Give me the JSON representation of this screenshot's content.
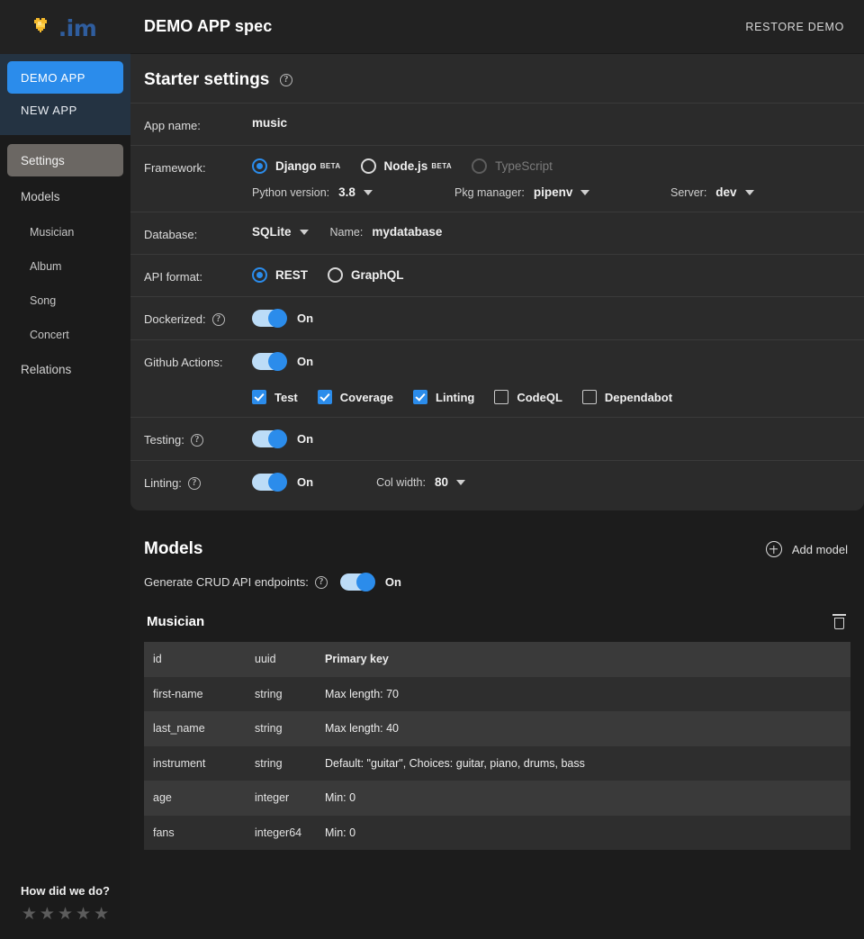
{
  "topbar": {
    "logo_icon": "heart-pixel-icon",
    "logo_text": ".im",
    "title": "DEMO APP spec",
    "restore_label": "RESTORE DEMO"
  },
  "sidebar": {
    "apps": [
      {
        "label": "DEMO APP",
        "active": true
      },
      {
        "label": "NEW APP",
        "active": false
      }
    ],
    "nav": [
      {
        "label": "Settings",
        "selected": true
      },
      {
        "label": "Models",
        "selected": false
      },
      {
        "label": "Musician",
        "sub": true
      },
      {
        "label": "Album",
        "sub": true
      },
      {
        "label": "Song",
        "sub": true
      },
      {
        "label": "Concert",
        "sub": true
      },
      {
        "label": "Relations",
        "selected": false
      }
    ],
    "rating": {
      "label": "How did we do?",
      "stars": 5,
      "filled": 0,
      "star_glyph": "★"
    }
  },
  "settings": {
    "title": "Starter settings",
    "app_name": {
      "label": "App name:",
      "value": "music"
    },
    "framework": {
      "label": "Framework:",
      "options": [
        {
          "label": "Django",
          "badge": "BETA",
          "selected": true,
          "disabled": false
        },
        {
          "label": "Node.js",
          "badge": "BETA",
          "selected": false,
          "disabled": false
        },
        {
          "label": "TypeScript",
          "badge": "",
          "selected": false,
          "disabled": true
        }
      ],
      "python_version": {
        "label": "Python version:",
        "value": "3.8"
      },
      "pkg_manager": {
        "label": "Pkg manager:",
        "value": "pipenv"
      },
      "server": {
        "label": "Server:",
        "value": "dev"
      }
    },
    "database": {
      "label": "Database:",
      "engine": "SQLite",
      "name_label": "Name:",
      "name_value": "mydatabase"
    },
    "api_format": {
      "label": "API format:",
      "options": [
        {
          "label": "REST",
          "selected": true
        },
        {
          "label": "GraphQL",
          "selected": false
        }
      ]
    },
    "dockerized": {
      "label": "Dockerized:",
      "state": "On"
    },
    "github_actions": {
      "label": "Github Actions:",
      "state": "On",
      "checks": [
        {
          "label": "Test",
          "checked": true
        },
        {
          "label": "Coverage",
          "checked": true
        },
        {
          "label": "Linting",
          "checked": true
        },
        {
          "label": "CodeQL",
          "checked": false
        },
        {
          "label": "Dependabot",
          "checked": false
        }
      ]
    },
    "testing": {
      "label": "Testing:",
      "state": "On"
    },
    "linting": {
      "label": "Linting:",
      "state": "On",
      "col_width_label": "Col width:",
      "col_width_value": "80"
    }
  },
  "models": {
    "title": "Models",
    "add_model_label": "Add model",
    "crud": {
      "label": "Generate CRUD API endpoints:",
      "state": "On"
    },
    "card": {
      "name": "Musician",
      "rows": [
        {
          "name": "id",
          "type": "uuid",
          "options": "Primary key"
        },
        {
          "name": "first-name",
          "type": "string",
          "options": "Max length: 70"
        },
        {
          "name": "last_name",
          "type": "string",
          "options": "Max length: 40"
        },
        {
          "name": "instrument",
          "type": "string",
          "options": "Default: \"guitar\", Choices: guitar, piano, drums, bass"
        },
        {
          "name": "age",
          "type": "integer",
          "options": "Min: 0"
        },
        {
          "name": "fans",
          "type": "integer64",
          "options": "Min: 0"
        }
      ]
    }
  },
  "colors": {
    "accent": "#2b8ceb",
    "sidebar_app_bg": "#243342",
    "panel_bg": "#2b2b2b",
    "page_bg": "#1c1c1c",
    "logo_heart": "#f5b92b",
    "logo_text": "#2f5d9e"
  }
}
